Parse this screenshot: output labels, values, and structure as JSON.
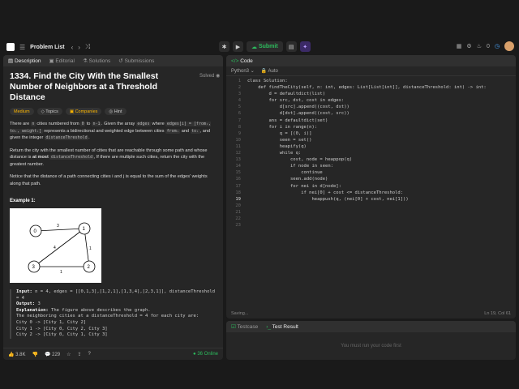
{
  "nav": {
    "problem_list": "Problem List",
    "submit": "Submit"
  },
  "right_counts": {
    "fire": "0"
  },
  "left": {
    "tabs": [
      "Description",
      "Editorial",
      "Solutions",
      "Submissions"
    ],
    "title": "1334. Find the City With the Smallest Number of Neighbors at a Threshold Distance",
    "solved": "Solved",
    "tags": [
      "Medium",
      "Topics",
      "Companies",
      "Hint"
    ],
    "p1_a": "There are ",
    "p1_n": "n",
    "p1_b": " cities numbered from ",
    "p1_0": "0",
    "p1_c": " to ",
    "p1_n1": "n-1",
    "p1_d": ". Given the array ",
    "p1_edges": "edges",
    "p1_e": " where ",
    "p1_ei": "edges[i] = [fromᵢ, toᵢ, weightᵢ]",
    "p1_f": " represents a bidirectional and weighted edge between cities ",
    "p1_from": "fromᵢ",
    "p1_g": " and ",
    "p1_to": "toᵢ",
    "p1_h": ", and given the integer ",
    "p1_dt": "distanceThreshold",
    "p1_i": ".",
    "p2_a": "Return the city with the smallest number of cities that are reachable through some path and whose distance is ",
    "p2_bold": "at most",
    "p2_b": " ",
    "p2_code": "distanceThreshold",
    "p2_c": ", If there are multiple such cities, return the city with the greatest number.",
    "p3": "Notice that the distance of a path connecting cities i and j is equal to the sum of the edges' weights along that path.",
    "example_title": "Example 1:",
    "graph": {
      "nodes": [
        "0",
        "1",
        "2",
        "3"
      ],
      "weights": [
        "3",
        "1",
        "4",
        "1"
      ]
    },
    "example": {
      "input_label": "Input:",
      "input": " n = 4, edges = [[0,1,3],[1,2,1],[1,3,4],[2,3,1]], distanceThreshold = 4",
      "output_label": "Output:",
      "output": " 3",
      "explanation_label": "Explanation:",
      "explanation": " The figure above describes the graph.",
      "lines": [
        "The neighboring cities at a distanceThreshold = 4 for each city are:",
        "City 0 -> [City 1, City 2]",
        "City 1 -> [City 0, City 2, City 3]",
        "City 2 -> [City 0, City 1, City 3]"
      ]
    },
    "footer": {
      "likes": "3.8K",
      "comments": "229",
      "online": "36 Online"
    }
  },
  "code": {
    "tab": "Code",
    "language": "Python3",
    "auto": "Auto",
    "lines": [
      "class Solution:",
      "    def findTheCity(self, n: int, edges: List[List[int]], distanceThreshold: int) -> int:",
      "        d = defaultdict(list)",
      "        for src, dst, cost in edges:",
      "            d[src].append((cost, dst))",
      "            d[dst].append((cost, src))",
      "        ans = defaultdict(set)",
      "        for i in range(n):",
      "            q = [(0, i)]",
      "            seen = set()",
      "            heapify(q)",
      "            while q:",
      "                cost, node = heappop(q)",
      "                if node in seen:",
      "                    continue",
      "                seen.add(node)",
      "                for nei in d[node]:",
      "                    if nei[0] + cost <= distanceThreshold:",
      "                        heappush(q, (nei[0] + cost, nei[1]))",
      "",
      "",
      "",
      ""
    ],
    "current_line": 19,
    "status": "Saving...",
    "cursor": "Ln 19, Col 61"
  },
  "test": {
    "tabs": [
      "Testcase",
      "Test Result"
    ],
    "message": "You must run your code first"
  }
}
